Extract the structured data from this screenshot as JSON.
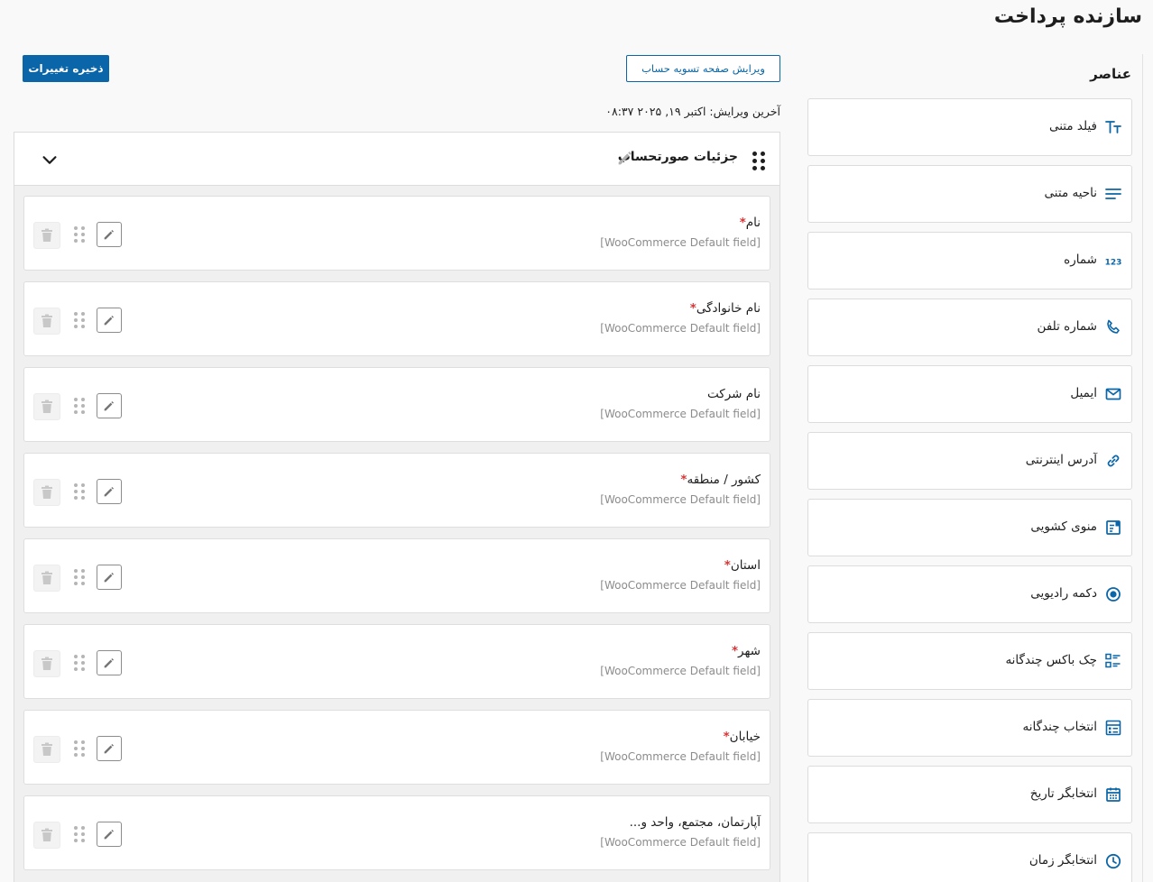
{
  "page": {
    "title": "سازنده پرداخت"
  },
  "toolbar": {
    "save_label": "ذخیره تغییرات",
    "edit_checkout_label": "ویرایش صفحه تسویه حساب",
    "last_edited": "آخرین ویرایش: اکتبر ۱۹, ۲۰۲۵ ۰۸:۳۷"
  },
  "section": {
    "title": "جزئیات صورتحساب"
  },
  "fields": [
    {
      "label": "نام",
      "required": "*",
      "sub": "[WooCommerce Default field]"
    },
    {
      "label": "نام خانوادگی",
      "required": "*",
      "sub": "[WooCommerce Default field]"
    },
    {
      "label": "نام شرکت",
      "required": "",
      "sub": "[WooCommerce Default field]"
    },
    {
      "label": "کشور / منطقه",
      "required": "*",
      "sub": "[WooCommerce Default field]"
    },
    {
      "label": "استان",
      "required": "*",
      "sub": "[WooCommerce Default field]"
    },
    {
      "label": "شهر",
      "required": "*",
      "sub": "[WooCommerce Default field]"
    },
    {
      "label": "خیابان",
      "required": "*",
      "sub": "[WooCommerce Default field]"
    },
    {
      "label": "آپارتمان، مجتمع، واحد و...",
      "required": "",
      "sub": "[WooCommerce Default field]"
    }
  ],
  "elements": {
    "title": "عناصر",
    "items": [
      {
        "label": "فیلد متنی",
        "icon": "text-field-icon",
        "slug": "text-field"
      },
      {
        "label": "ناحیه متنی",
        "icon": "textarea-icon",
        "slug": "textarea"
      },
      {
        "label": "شماره",
        "icon": "number-icon",
        "slug": "number"
      },
      {
        "label": "شماره تلفن",
        "icon": "phone-icon",
        "slug": "phone"
      },
      {
        "label": "ایمیل",
        "icon": "email-icon",
        "slug": "email"
      },
      {
        "label": "آدرس اینترنتی",
        "icon": "link-icon",
        "slug": "url"
      },
      {
        "label": "منوی کشویی",
        "icon": "dropdown-icon",
        "slug": "dropdown"
      },
      {
        "label": "دکمه رادیویی",
        "icon": "radio-icon",
        "slug": "radio"
      },
      {
        "label": "چک باکس چندگانه",
        "icon": "checklist-icon",
        "slug": "multi-checkbox"
      },
      {
        "label": "انتخاب چندگانه",
        "icon": "multi-select-icon",
        "slug": "multi-select"
      },
      {
        "label": "انتخابگر تاریخ",
        "icon": "calendar-icon",
        "slug": "date-picker"
      },
      {
        "label": "انتخابگر زمان",
        "icon": "clock-icon",
        "slug": "time-picker"
      }
    ]
  },
  "colors": {
    "accent": "#0a66a8",
    "required": "#d63638",
    "muted": "#8c8c8c"
  }
}
